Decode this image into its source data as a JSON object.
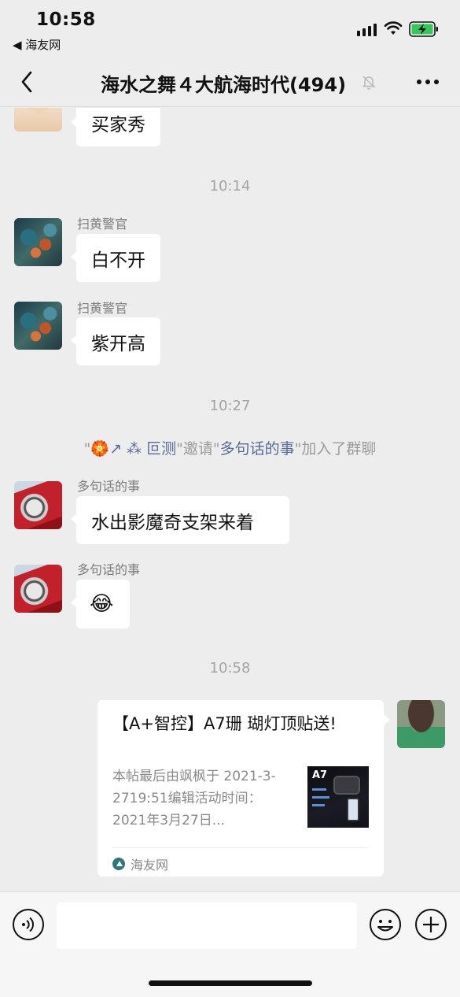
{
  "status_bar": {
    "time": "10:58",
    "back_app": "◀ 海友网"
  },
  "nav": {
    "title": "海水之舞４大航海时代(494)"
  },
  "messages": {
    "m0": {
      "text": "买家秀"
    },
    "t1": "10:14",
    "m1": {
      "sender": "扫黄警官",
      "text": "白不开"
    },
    "m2": {
      "sender": "扫黄警官",
      "text": "紫开高"
    },
    "t2": "10:27",
    "system": {
      "q1": "\"",
      "inviter": "🏵️↗ ⁂ 叵测",
      "mid": "\"邀请\"",
      "invitee": "多句话的事",
      "tail": "\"加入了群聊"
    },
    "m3": {
      "sender": "多句话的事",
      "text": "水出影魔奇支架来着"
    },
    "m4": {
      "sender": "多句话的事",
      "text": "😂"
    },
    "t3": "10:58"
  },
  "card": {
    "title": "【A+智控】A7珊 瑚灯顶贴送!",
    "desc": "本帖最后由飒枫于 2021-3-2719:51编辑活动时间：2021年3月27日...",
    "thumb_label": "A7",
    "source": "海友网"
  },
  "input": {
    "placeholder": ""
  },
  "colors": {
    "background": "#ededed",
    "bubble": "#ffffff",
    "link_name": "#576b95",
    "input_bar": "#f6f6f6"
  }
}
